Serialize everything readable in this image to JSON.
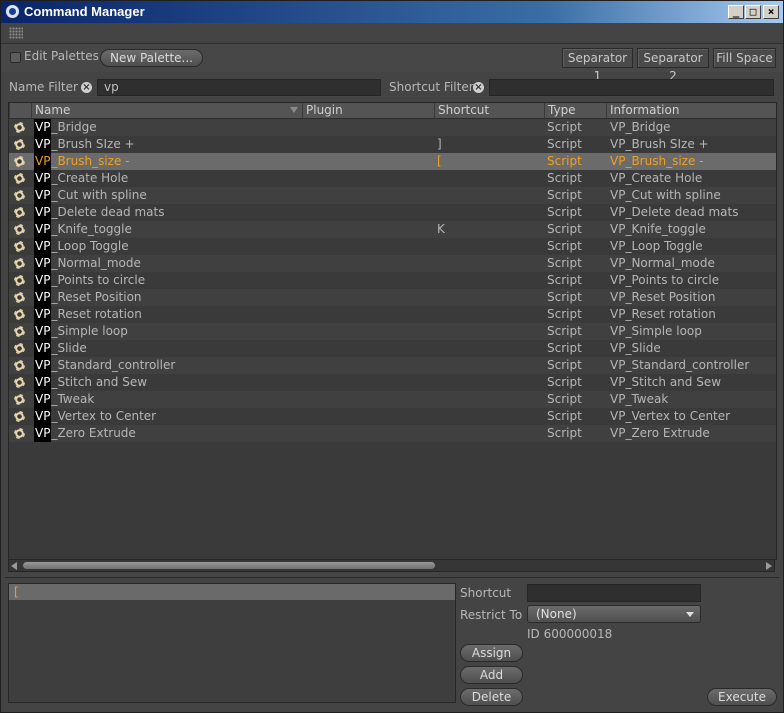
{
  "window": {
    "title": "Command Manager",
    "controls": [
      "_",
      "□",
      "×"
    ]
  },
  "toolbar": {
    "edit_palettes_label": "Edit Palettes",
    "new_palette_label": "New Palette...",
    "separator1_label": "Separator 1",
    "separator2_label": "Separator 2",
    "fill_space_label": "Fill Space"
  },
  "filters": {
    "name_label": "Name Filter",
    "name_value": "vp",
    "shortcut_label": "Shortcut Filter",
    "shortcut_value": ""
  },
  "table": {
    "columns": [
      "Name",
      "Plugin",
      "Shortcut",
      "Type",
      "Information"
    ],
    "selected_index": 2,
    "rows": [
      {
        "prefix": "VP",
        "name": "_Bridge",
        "plugin": "",
        "shortcut": "",
        "type": "Script",
        "info": "VP_Bridge"
      },
      {
        "prefix": "VP",
        "name": "_Brush SIze +",
        "plugin": "",
        "shortcut": "]",
        "type": "Script",
        "info": "VP_Brush SIze +"
      },
      {
        "prefix": "VP",
        "name": "_Brush_size -",
        "plugin": "",
        "shortcut": "[",
        "type": "Script",
        "info": "VP_Brush_size -"
      },
      {
        "prefix": "VP",
        "name": "_Create Hole",
        "plugin": "",
        "shortcut": "",
        "type": "Script",
        "info": "VP_Create Hole"
      },
      {
        "prefix": "VP",
        "name": "_Cut with spline",
        "plugin": "",
        "shortcut": "",
        "type": "Script",
        "info": "VP_Cut with spline"
      },
      {
        "prefix": "VP",
        "name": "_Delete dead mats",
        "plugin": "",
        "shortcut": "",
        "type": "Script",
        "info": "VP_Delete dead mats"
      },
      {
        "prefix": "VP",
        "name": "_Knife_toggle",
        "plugin": "",
        "shortcut": "K",
        "type": "Script",
        "info": "VP_Knife_toggle"
      },
      {
        "prefix": "VP",
        "name": "_Loop Toggle",
        "plugin": "",
        "shortcut": "",
        "type": "Script",
        "info": "VP_Loop Toggle"
      },
      {
        "prefix": "VP",
        "name": "_Normal_mode",
        "plugin": "",
        "shortcut": "",
        "type": "Script",
        "info": "VP_Normal_mode"
      },
      {
        "prefix": "VP",
        "name": "_Points to circle",
        "plugin": "",
        "shortcut": "",
        "type": "Script",
        "info": "VP_Points to circle"
      },
      {
        "prefix": "VP",
        "name": "_Reset Position",
        "plugin": "",
        "shortcut": "",
        "type": "Script",
        "info": "VP_Reset Position"
      },
      {
        "prefix": "VP",
        "name": "_Reset rotation",
        "plugin": "",
        "shortcut": "",
        "type": "Script",
        "info": "VP_Reset rotation"
      },
      {
        "prefix": "VP",
        "name": "_Simple loop",
        "plugin": "",
        "shortcut": "",
        "type": "Script",
        "info": "VP_Simple loop"
      },
      {
        "prefix": "VP",
        "name": "_Slide",
        "plugin": "",
        "shortcut": "",
        "type": "Script",
        "info": "VP_Slide"
      },
      {
        "prefix": "VP",
        "name": "_Standard_controller",
        "plugin": "",
        "shortcut": "",
        "type": "Script",
        "info": "VP_Standard_controller"
      },
      {
        "prefix": "VP",
        "name": "_Stitch and Sew",
        "plugin": "",
        "shortcut": "",
        "type": "Script",
        "info": "VP_Stitch and Sew"
      },
      {
        "prefix": "VP",
        "name": "_Tweak",
        "plugin": "",
        "shortcut": "",
        "type": "Script",
        "info": "VP_Tweak"
      },
      {
        "prefix": "VP",
        "name": "_Vertex to Center",
        "plugin": "",
        "shortcut": "",
        "type": "Script",
        "info": "VP_Vertex to Center"
      },
      {
        "prefix": "VP",
        "name": "_Zero Extrude",
        "plugin": "",
        "shortcut": "",
        "type": "Script",
        "info": "VP_Zero Extrude"
      }
    ]
  },
  "bottom": {
    "assigned_shortcut": "[",
    "shortcut_label": "Shortcut",
    "shortcut_value": "",
    "restrict_label": "Restrict To",
    "restrict_value": "(None)",
    "id_text": "ID 600000018",
    "assign_label": "Assign",
    "add_label": "Add",
    "delete_label": "Delete",
    "execute_label": "Execute"
  }
}
